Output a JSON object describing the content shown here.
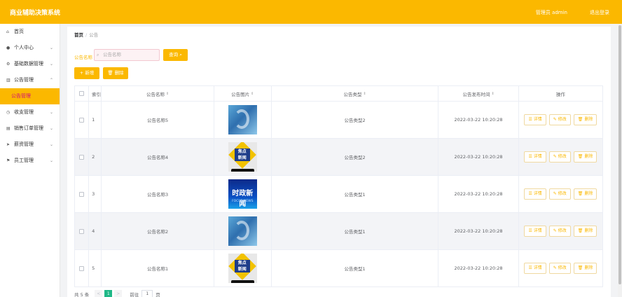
{
  "header": {
    "title": "商业辅助决策系统",
    "user": "管理员 admin",
    "logout": "退出登录"
  },
  "sidebar": {
    "items": [
      {
        "label": "首页",
        "icon": "home-icon"
      },
      {
        "label": "个人中心",
        "icon": "user-icon"
      },
      {
        "label": "基础数据管理",
        "icon": "settings-icon"
      },
      {
        "label": "公告管理",
        "icon": "chart-icon"
      },
      {
        "label": "公告管理",
        "icon": ""
      },
      {
        "label": "收支管理",
        "icon": "clock-icon"
      },
      {
        "label": "销售订单管理",
        "icon": "list-icon"
      },
      {
        "label": "薪资管理",
        "icon": "send-icon"
      },
      {
        "label": "员工管理",
        "icon": "flag-icon"
      }
    ]
  },
  "breadcrumb": {
    "home": "首页",
    "separator": "/",
    "current": "公告"
  },
  "search": {
    "label": "公告名称",
    "placeholder": "公告名称",
    "button": "查询"
  },
  "toolbar": {
    "add": "+ 新增",
    "delete": "删除"
  },
  "table": {
    "headers": {
      "index": "索引",
      "name": "公告名称",
      "image": "公告图片",
      "type": "公告类型",
      "time": "公告发布时间",
      "ops": "操作"
    },
    "rows": [
      {
        "index": "1",
        "name": "公告名称5",
        "image": "t1",
        "type": "公告类型2",
        "time": "2022-03-22 10:20:28"
      },
      {
        "index": "2",
        "name": "公告名称4",
        "image": "t2",
        "type": "公告类型2",
        "time": "2022-03-22 10:20:28"
      },
      {
        "index": "3",
        "name": "公告名称3",
        "image": "t3",
        "type": "公告类型1",
        "time": "2022-03-22 10:20:28"
      },
      {
        "index": "4",
        "name": "公告名称2",
        "image": "t1",
        "type": "公告类型1",
        "time": "2022-03-22 10:20:28"
      },
      {
        "index": "5",
        "name": "公告名称1",
        "image": "t2",
        "type": "公告类型1",
        "time": "2022-03-22 10:20:28"
      }
    ],
    "actions": {
      "detail": "详情",
      "edit": "修改",
      "delete": "删除"
    },
    "thumb_text": {
      "t2_line1": "焦点",
      "t2_line2": "新闻",
      "t3_big": "时政新闻",
      "t3_small": "FOCUS NEWS"
    }
  },
  "pagination": {
    "total": "共 5 条",
    "prev": "<",
    "current_page": "1",
    "next": ">",
    "goto_label": "前往",
    "goto_value": "1",
    "page_suffix": "页"
  },
  "colors": {
    "accent": "#fbb800",
    "active_text": "#d10c7b",
    "page_active": "#1fb887"
  }
}
